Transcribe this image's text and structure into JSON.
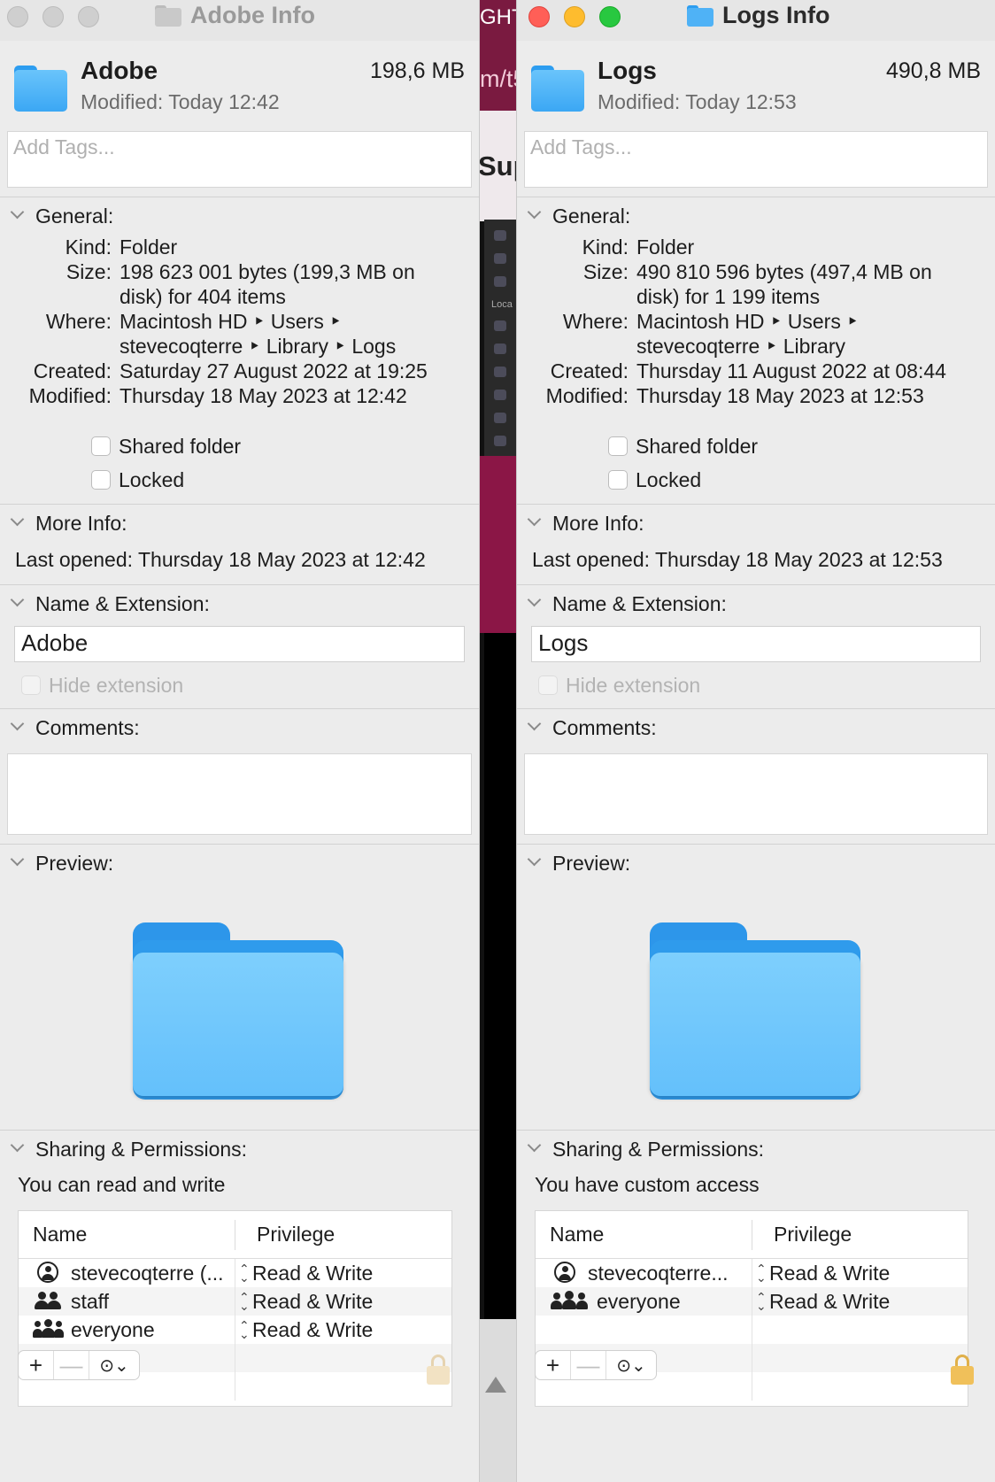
{
  "background": {
    "text_top": "GHT",
    "text_url": "m/t5",
    "text_sup": "Sup",
    "text_loca": "Loca"
  },
  "left_window": {
    "title": "Adobe Info",
    "name": "Adobe",
    "size": "198,6 MB",
    "modified_header": "Modified:  Today 12:42",
    "tags_placeholder": "Add Tags...",
    "general": {
      "heading": "General:",
      "kind_label": "Kind:",
      "kind": "Folder",
      "size_label": "Size:",
      "size_line1": "198 623 001 bytes (199,3 MB on",
      "size_line2": "disk) for 404 items",
      "where_label": "Where:",
      "where_line1": "Macintosh HD ‣ Users ‣",
      "where_line2": "stevecoqterre ‣ Library ‣ Logs",
      "created_label": "Created:",
      "created": "Saturday 27 August 2022 at 19:25",
      "modified_label": "Modified:",
      "modified": "Thursday 18 May 2023 at 12:42",
      "shared_folder": "Shared folder",
      "locked": "Locked"
    },
    "more_info": {
      "heading": "More Info:",
      "last_opened": "Last opened:  Thursday 18 May 2023 at 12:42"
    },
    "name_ext": {
      "heading": "Name & Extension:",
      "value": "Adobe",
      "hide_extension": "Hide extension"
    },
    "comments": {
      "heading": "Comments:"
    },
    "preview": {
      "heading": "Preview:"
    },
    "sharing": {
      "heading": "Sharing & Permissions:",
      "summary": "You can read and write",
      "col_name": "Name",
      "col_privilege": "Privilege",
      "rows": [
        {
          "name": "stevecoqterre (...",
          "privilege": "Read & Write",
          "icon": "user-circle-icon"
        },
        {
          "name": "staff",
          "privilege": "Read & Write",
          "icon": "group-icon"
        },
        {
          "name": "everyone",
          "privilege": "Read & Write",
          "icon": "everyone-icon"
        }
      ]
    }
  },
  "right_window": {
    "title": "Logs Info",
    "name": "Logs",
    "size": "490,8 MB",
    "modified_header": "Modified:  Today 12:53",
    "tags_placeholder": "Add Tags...",
    "general": {
      "heading": "General:",
      "kind_label": "Kind:",
      "kind": "Folder",
      "size_label": "Size:",
      "size_line1": "490 810 596 bytes (497,4 MB on",
      "size_line2": "disk) for 1 199 items",
      "where_label": "Where:",
      "where_line1": "Macintosh HD ‣ Users ‣",
      "where_line2": "stevecoqterre ‣ Library",
      "created_label": "Created:",
      "created": "Thursday 11 August 2022 at 08:44",
      "modified_label": "Modified:",
      "modified": "Thursday 18 May 2023 at 12:53",
      "shared_folder": "Shared folder",
      "locked": "Locked"
    },
    "more_info": {
      "heading": "More Info:",
      "last_opened": "Last opened:  Thursday 18 May 2023 at 12:53"
    },
    "name_ext": {
      "heading": "Name & Extension:",
      "value": "Logs",
      "hide_extension": "Hide extension"
    },
    "comments": {
      "heading": "Comments:"
    },
    "preview": {
      "heading": "Preview:"
    },
    "sharing": {
      "heading": "Sharing & Permissions:",
      "summary": "You have custom access",
      "col_name": "Name",
      "col_privilege": "Privilege",
      "rows": [
        {
          "name": "stevecoqterre...",
          "privilege": "Read & Write",
          "icon": "user-circle-icon"
        },
        {
          "name": "everyone",
          "privilege": "Read & Write",
          "icon": "everyone-icon"
        }
      ]
    }
  },
  "toolbar": {
    "add": "+",
    "remove": "—",
    "action": "⊙⌄"
  },
  "colors": {
    "folder_blue": "#3ba7f4",
    "lock_gold": "#f0c05a",
    "close_red": "#ff5f57",
    "minimize_yellow": "#febc2e",
    "zoom_green": "#28c840"
  }
}
